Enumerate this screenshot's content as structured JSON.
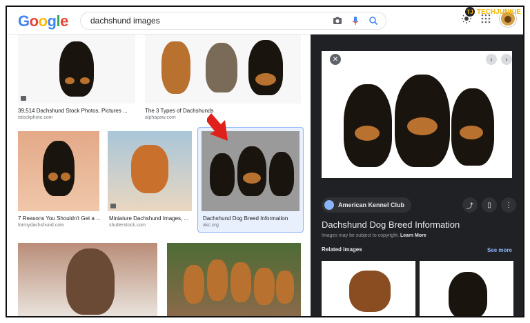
{
  "header": {
    "logo": [
      "G",
      "o",
      "o",
      "g",
      "l",
      "e"
    ],
    "logo_colors": [
      "#4285f4",
      "#ea4335",
      "#fbbc05",
      "#4285f4",
      "#34a853",
      "#ea4335"
    ],
    "search_query": "dachshund images",
    "icons": [
      "camera-icon",
      "mic-icon",
      "search-icon",
      "brightness-icon",
      "apps-grid-icon",
      "avatar"
    ]
  },
  "watermark": {
    "text": "TECHJUNKIE",
    "badge": "TJ"
  },
  "results": [
    {
      "title": "39,514 Dachshund Stock Photos, Pictures ...",
      "source": "istockphoto.com"
    },
    {
      "title": "The 3 Types of Dachshunds",
      "source": "alphapaw.com"
    },
    {
      "title": "7 Reasons You Shouldn't Get a ...",
      "source": "formydachshund.com"
    },
    {
      "title": "Miniature Dachshund Images, ...",
      "source": "shutterstock.com"
    },
    {
      "title": "Dachshund Dog Breed Information",
      "source": "akc.org"
    }
  ],
  "panel": {
    "source_chip": "American Kennel Club",
    "title": "Dachshund Dog Breed Information",
    "copyright": "Images may be subject to copyright.",
    "learn_more": "Learn More",
    "related_label": "Related images",
    "see_more": "See more",
    "close": "✕",
    "prev": "‹",
    "next": "›",
    "share": "⤴",
    "save": "▯",
    "more": "⋮"
  },
  "colors": {
    "accent": "#8ab4f8",
    "panel_bg": "#202124",
    "arrow": "#e0201b"
  }
}
